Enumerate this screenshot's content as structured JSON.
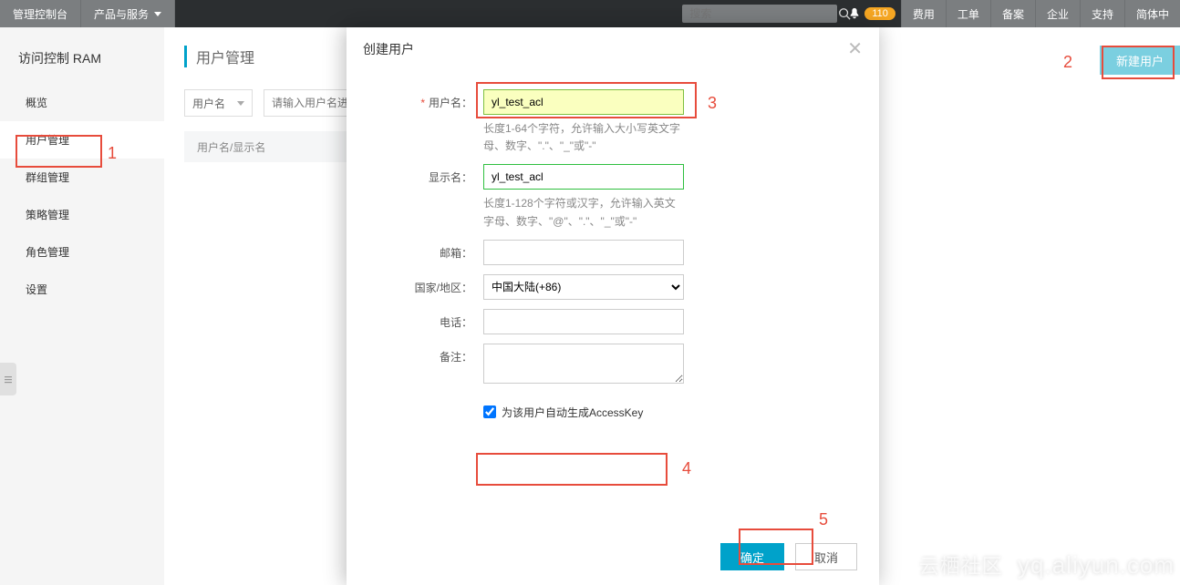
{
  "topbar": {
    "console": "管理控制台",
    "products": "产品与服务",
    "search_placeholder": "搜索",
    "badge": "110",
    "right": [
      "费用",
      "工单",
      "备案",
      "企业",
      "支持",
      "简体中"
    ]
  },
  "sidebar": {
    "title": "访问控制 RAM",
    "items": [
      "概览",
      "用户管理",
      "群组管理",
      "策略管理",
      "角色管理",
      "设置"
    ],
    "active_index": 1
  },
  "main": {
    "page_title": "用户管理",
    "filter_label": "用户名",
    "filter_placeholder": "请输入用户名进",
    "table_col1": "用户名/显示名",
    "new_user_btn": "新建用户"
  },
  "modal": {
    "title": "创建用户",
    "fields": {
      "username": {
        "label": "用户名：",
        "value": "yl_test_acl",
        "hint": "长度1-64个字符，允许输入大小写英文字母、数字、\".\"、\"_\"或\"-\""
      },
      "display": {
        "label": "显示名：",
        "value": "yl_test_acl",
        "hint": "长度1-128个字符或汉字，允许输入英文字母、数字、\"@\"、\".\"、\"_\"或\"-\""
      },
      "email": {
        "label": "邮箱：",
        "value": ""
      },
      "region": {
        "label": "国家/地区：",
        "value": "中国大陆(+86)"
      },
      "phone": {
        "label": "电话：",
        "value": ""
      },
      "remark": {
        "label": "备注：",
        "value": ""
      }
    },
    "accesskey_label": "为该用户自动生成AccessKey",
    "accesskey_checked": true,
    "ok": "确定",
    "cancel": "取消"
  },
  "annotations": {
    "a1": "1",
    "a2": "2",
    "a3": "3",
    "a4": "4",
    "a5": "5"
  },
  "watermark": {
    "cn": "云栖社区",
    "en": "yq.aliyun.com"
  }
}
